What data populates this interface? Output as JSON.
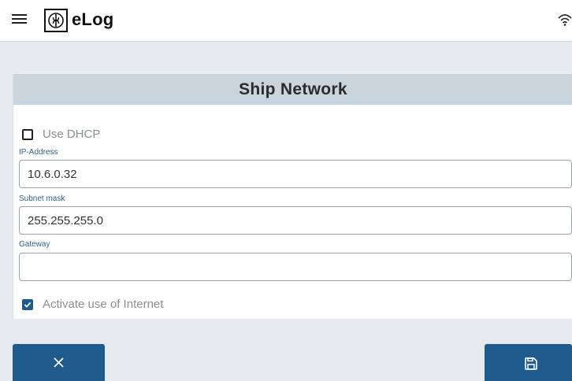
{
  "app": {
    "name": "eLog"
  },
  "icons": {
    "menu": "hamburger-menu-icon",
    "logo": "elog-logo-icon",
    "wifi": "wifi-icon",
    "cancel": "close-icon",
    "save": "floppy-disk-icon"
  },
  "colors": {
    "accent": "#1f5b8c",
    "header_band": "#c9d4dd",
    "page_background": "#e7ebef"
  },
  "card": {
    "title": "Ship Network"
  },
  "form": {
    "use_dhcp": {
      "label": "Use DHCP",
      "checked": false
    },
    "ip_address": {
      "label": "IP-Address",
      "value": "10.6.0.32"
    },
    "subnet_mask": {
      "label": "Subnet mask",
      "value": "255.255.255.0"
    },
    "gateway": {
      "label": "Gateway",
      "value": ""
    },
    "internet": {
      "label": "Activate use of Internet",
      "checked": true
    }
  }
}
